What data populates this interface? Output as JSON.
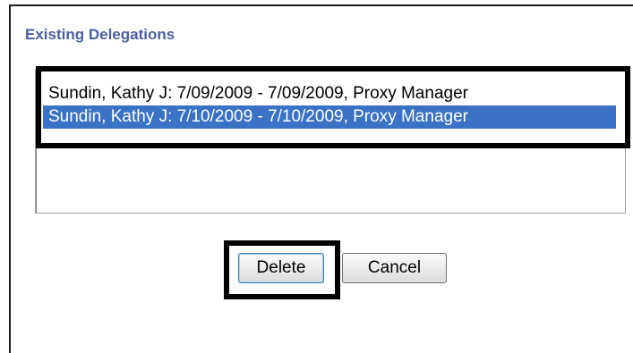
{
  "dialog": {
    "title": "Existing Delegations",
    "delegations": [
      {
        "label": "Sundin, Kathy J: 7/09/2009 - 7/09/2009, Proxy Manager",
        "selected": false
      },
      {
        "label": "Sundin, Kathy J: 7/10/2009 - 7/10/2009, Proxy Manager",
        "selected": true
      }
    ],
    "buttons": {
      "delete_label": "Delete",
      "cancel_label": "Cancel"
    }
  },
  "colors": {
    "title_text": "#4a5fa0",
    "selection_bg": "#3a72c6",
    "annotation_frame": "#000000"
  }
}
